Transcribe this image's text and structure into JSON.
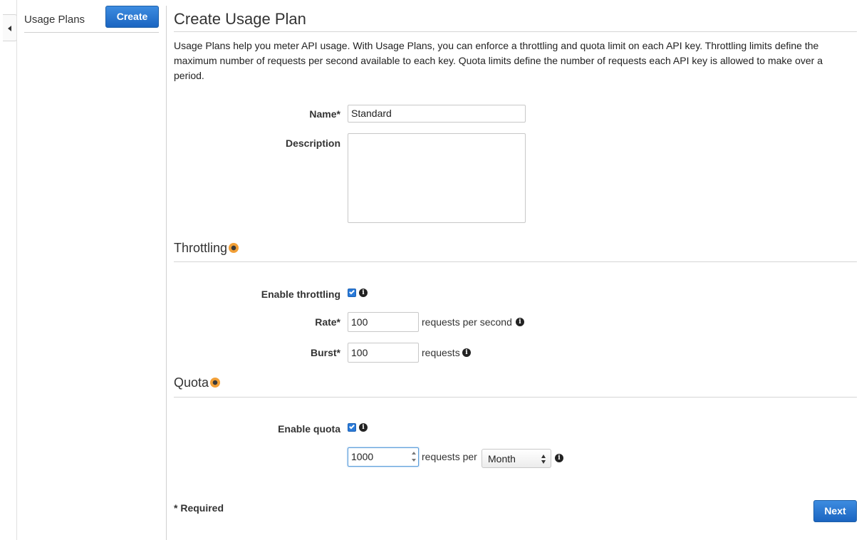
{
  "sidebar": {
    "title": "Usage Plans",
    "create_label": "Create",
    "collapse_icon": "triangle-left-icon"
  },
  "main": {
    "title": "Create Usage Plan",
    "description": "Usage Plans help you meter API usage. With Usage Plans, you can enforce a throttling and quota limit on each API key. Throttling limits define the maximum number of requests per second available to each key. Quota limits define the number of requests each API key is allowed to make over a period."
  },
  "form": {
    "name_label": "Name*",
    "name_value": "Standard",
    "description_label": "Description",
    "description_value": ""
  },
  "throttling": {
    "title": "Throttling",
    "enable_label": "Enable throttling",
    "enabled": true,
    "rate_label": "Rate*",
    "rate_value": "100",
    "rate_unit": "requests per second",
    "burst_label": "Burst*",
    "burst_value": "100",
    "burst_unit": "requests"
  },
  "quota": {
    "title": "Quota",
    "enable_label": "Enable quota",
    "enabled": true,
    "limit_value": "1000",
    "limit_unit": "requests per",
    "period_value": "Month"
  },
  "footer": {
    "required_note": "* Required",
    "next_label": "Next"
  },
  "colors": {
    "primary_button": "#1b65c1",
    "checkbox": "#2a7ad8",
    "help_icon": "#f2a038"
  },
  "icons": [
    "info-icon",
    "help-icon",
    "checkbox-icon"
  ]
}
